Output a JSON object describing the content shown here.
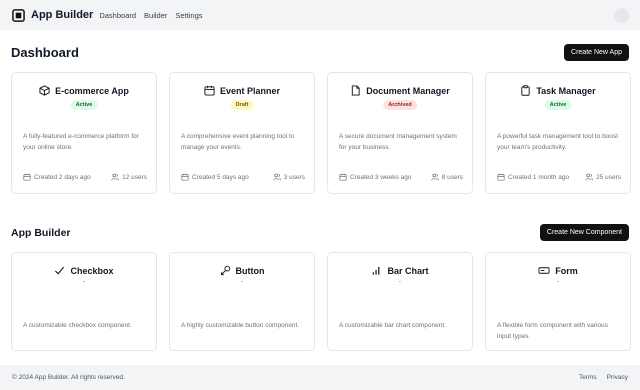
{
  "header": {
    "brand": "App Builder",
    "nav": [
      "Dashboard",
      "Builder",
      "Settings"
    ]
  },
  "dashboard": {
    "title": "Dashboard",
    "create_label": "Create New App",
    "apps": [
      {
        "name": "E-commerce App",
        "icon": "box-icon",
        "status": "Active",
        "status_kind": "active",
        "description": "A fully-featured e-commerce platform for your online store.",
        "created": "Created 2 days ago",
        "users": "12 users"
      },
      {
        "name": "Event Planner",
        "icon": "calendar-icon",
        "status": "Draft",
        "status_kind": "draft",
        "description": "A comprehensive event planning tool to manage your events.",
        "created": "Created 5 days ago",
        "users": "3 users"
      },
      {
        "name": "Document Manager",
        "icon": "file-icon",
        "status": "Archived",
        "status_kind": "archived",
        "description": "A secure document management system for your business.",
        "created": "Created 3 weeks ago",
        "users": "8 users"
      },
      {
        "name": "Task Manager",
        "icon": "clipboard-icon",
        "status": "Active",
        "status_kind": "active",
        "description": "A powerful task management tool to boost your team's productivity.",
        "created": "Created 1 month ago",
        "users": "25 users"
      }
    ]
  },
  "builder": {
    "title": "App Builder",
    "create_label": "Create New Component",
    "components": [
      {
        "name": "Checkbox",
        "icon": "check-icon",
        "description": "A customizable checkbox component."
      },
      {
        "name": "Button",
        "icon": "pointer-icon",
        "description": "A highly customizable button component."
      },
      {
        "name": "Bar Chart",
        "icon": "bar-chart-icon",
        "description": "A customizable bar chart component."
      },
      {
        "name": "Form",
        "icon": "form-icon",
        "description": "A flexible form component with various input types."
      }
    ]
  },
  "footer": {
    "copyright": "© 2024 App Builder. All rights reserved.",
    "links": [
      "Terms",
      "Privacy"
    ]
  }
}
